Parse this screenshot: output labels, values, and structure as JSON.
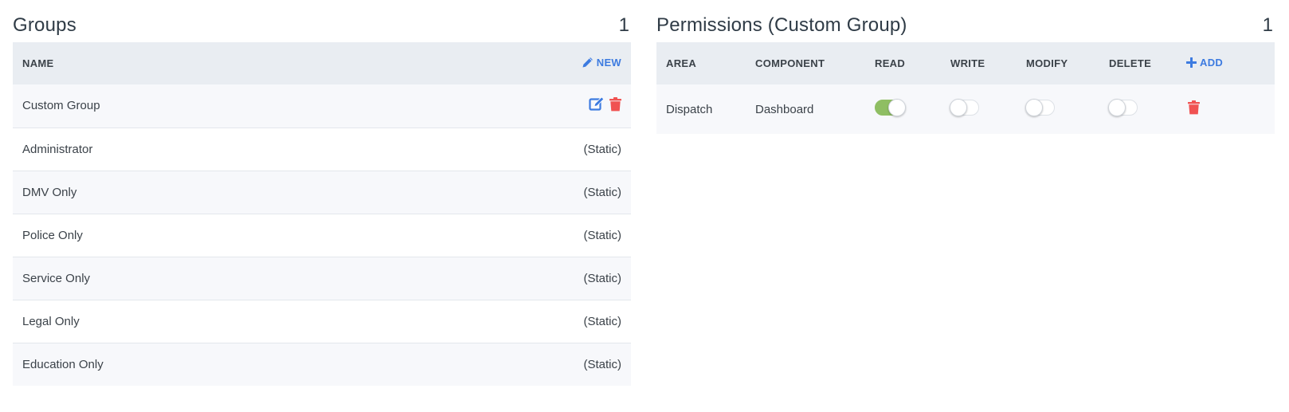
{
  "groups_panel": {
    "title": "Groups",
    "count": "1",
    "columns": {
      "name": "NAME",
      "new_label": "NEW"
    },
    "rows": [
      {
        "name": "Custom Group",
        "status": ""
      },
      {
        "name": "Administrator",
        "status": "(Static)"
      },
      {
        "name": "DMV Only",
        "status": "(Static)"
      },
      {
        "name": "Police Only",
        "status": "(Static)"
      },
      {
        "name": "Service Only",
        "status": "(Static)"
      },
      {
        "name": "Legal Only",
        "status": "(Static)"
      },
      {
        "name": "Education Only",
        "status": "(Static)"
      }
    ]
  },
  "permissions_panel": {
    "title": "Permissions (Custom Group)",
    "count": "1",
    "columns": {
      "area": "AREA",
      "component": "COMPONENT",
      "read": "READ",
      "write": "WRITE",
      "modify": "MODIFY",
      "delete": "DELETE",
      "add_label": "ADD"
    },
    "rows": [
      {
        "area": "Dispatch",
        "component": "Dashboard",
        "read": true,
        "write": false,
        "modify": false,
        "delete": false
      }
    ]
  },
  "colors": {
    "accent": "#3d7be0",
    "danger": "#f05252",
    "toggle_on": "#8fbe63",
    "header_bg": "#e9edf2"
  },
  "icons": {
    "new": "pencil-icon",
    "edit": "edit-icon",
    "delete": "trash-icon",
    "add": "plus-icon"
  }
}
